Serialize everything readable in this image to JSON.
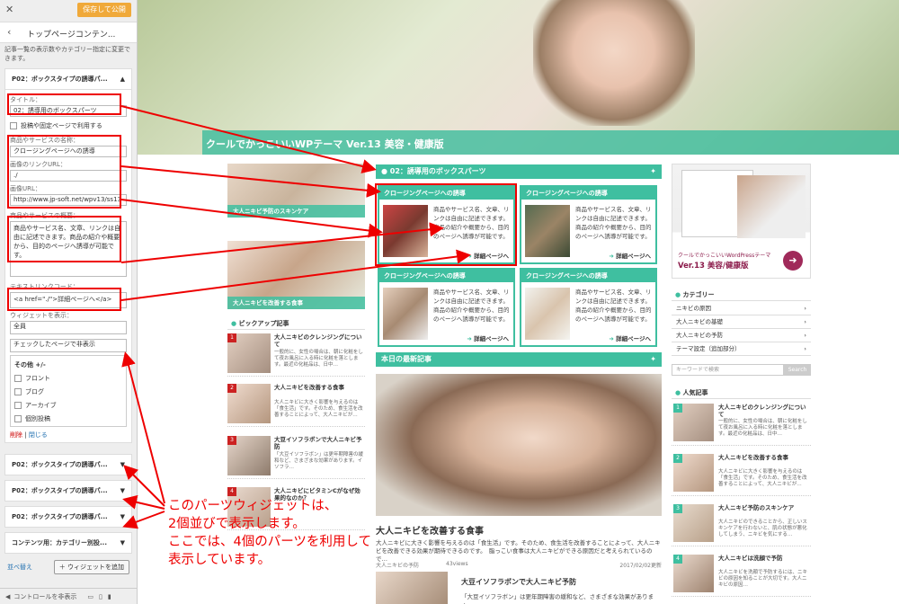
{
  "customizer": {
    "publish_label": "保存して公開",
    "section_title": "トップページコンテン...",
    "description": "記事一覧の表示数やカテゴリー指定に変更できます。",
    "widget_header": "P02：ボックスタイプの誘導パ...",
    "fields": {
      "title_label": "タイトル：",
      "title_value": "02：誘導用のボックスパーツ",
      "fixed_page_checkbox": "投稿や固定ページで利用する",
      "product_name_label": "商品やサービスの名称：",
      "product_name_value": "クロージングページへの誘導",
      "image_link_label": "画像のリンクURL：",
      "image_link_value": "./",
      "image_url_label": "画像URL：",
      "image_url_value": "http://www.jp-soft.net/wpv13/ss13",
      "summary_label": "商品やサービスの概要：",
      "summary_value": "商品やサービス名、文章、リンクは自由に記述できます。商品の紹介や概要から、目的のページへ誘導が可能です。",
      "text_link_label": "テキストリンクコード：",
      "text_link_value": "<a href=\"./\">詳細ページへ</a>",
      "widget_display_label": "ウィジェットを表示：",
      "widget_display_value": "全員",
      "hide_select_value": "チェックしたページで非表示",
      "list_header": "その他 +/-",
      "list_items": [
        "フロント",
        "ブログ",
        "アーカイブ",
        "個別投稿"
      ],
      "delete_label": "削除",
      "close_label": "閉じる"
    },
    "collapsed_widgets": [
      "P02：ボックスタイプの誘導パ...",
      "P02：ボックスタイプの誘導パ...",
      "P02：ボックスタイプの誘導パ...",
      "コンテンツ用：カテゴリー別投..."
    ],
    "reorder_label": "並べ替え",
    "add_widget_label": "＋ ウィジェットを追加",
    "hide_controls_label": "コントロールを非表示"
  },
  "site": {
    "hero_title": "クールでかっこいいWPテーマ Ver.13 美容・健康版",
    "box_section_title": "02：誘導用のボックスパーツ",
    "cards": [
      {
        "title": "クロージングページへの誘導",
        "text": "商品やサービス名、文章、リンクは自由に記述できます。商品の紹介や概要から、目的のページへ誘導が可能です。",
        "link": "詳細ページへ"
      },
      {
        "title": "クロージングページへの誘導",
        "text": "商品やサービス名、文章、リンクは自由に記述できます。商品の紹介や概要から、目的のページへ誘導が可能です。",
        "link": "詳細ページへ"
      },
      {
        "title": "クロージングページへの誘導",
        "text": "商品やサービス名、文章、リンクは自由に記述できます。商品の紹介や概要から、目的のページへ誘導が可能です。",
        "link": "詳細ページへ"
      },
      {
        "title": "クロージングページへの誘導",
        "text": "商品やサービス名、文章、リンクは自由に記述できます。商品の紹介や概要から、目的のページへ誘導が可能です。",
        "link": "詳細ページへ"
      }
    ],
    "side_banners": [
      "大人ニキビ予防のスキンケア",
      "大人ニキビを改善する食事"
    ],
    "pickup_title": "ピックアップ記事",
    "pickup_items": [
      {
        "num": "1",
        "title": "大人ニキビのクレンジングについて",
        "desc": "一般的に、女性の場合は、朝に化粧をして夜お風呂に入る時に化粧を落とします。最近の化粧品は、日中…"
      },
      {
        "num": "2",
        "title": "大人ニキビを改善する食事",
        "desc": "大人ニキビに大きく影響を与えるのは「食生活」です。そのため、食生活を改善することによって、大人ニキビが…"
      },
      {
        "num": "3",
        "title": "大豆イソフラボンで大人ニキビ予防",
        "desc": "「大豆イソフラボン」は更年期障害の緩和など、さまざまな効果があります。イソフラ…"
      },
      {
        "num": "4",
        "title": "大人ニキビにビタミンCがなぜ効果的なのか？",
        "desc": ""
      }
    ],
    "latest_title": "本日の最新記事",
    "article_title": "大人ニキビを改善する食事",
    "article_text": "大人ニキビに大きく影響を与えるのは「食生活」です。そのため、食生活を改善することによって、大人ニキビを改善できる効果が期待できるのです。　脂っこい食事は大人ニキビができる原因だと考えられているので…",
    "article_meta": [
      "大人ニキビの予防",
      "43views",
      "2017/02/02更新"
    ],
    "article2_title": "大豆イソフラボンで大人ニキビ予防",
    "article2_text": "「大豆イソフラボン」は更年期障害の緩和など、さまざまな効果があります。",
    "ad": {
      "line1": "クールでかっこいいWordPressテーマ",
      "line2": "Ver.13 美容/健康版"
    },
    "category_title": "カテゴリー",
    "categories": [
      "ニキビの原因",
      "大人ニキビの基礎",
      "大人ニキビの予防",
      "テーマ設定（追加部分）"
    ],
    "search_placeholder": "キーワードで検索",
    "search_button": "Search",
    "popular_title": "人気記事",
    "popular_items": [
      {
        "num": "1",
        "title": "大人ニキビのクレンジングについて",
        "desc": "一般的に、女性の場合は、朝に化粧をして夜お風呂に入る時に化粧を落とします。最近の化粧品は、日中…"
      },
      {
        "num": "2",
        "title": "大人ニキビを改善する食事",
        "desc": "大人ニキビに大きく影響を与えるのは「食生活」です。そのため、食生活を改善することによって、大人ニキビが…"
      },
      {
        "num": "3",
        "title": "大人ニキビ予防のスキンケア",
        "desc": "大人ニキビのできることから、正しいスキンケアを行わないと、肌の状態が悪化してしまう、ニキビを気にする…"
      },
      {
        "num": "4",
        "title": "大人ニキビは洗顔で予防",
        "desc": "大人ニキビを洗顔で予防するには、ニキビの原因を知ることが大切です。大人ニキビの原因…"
      }
    ]
  },
  "annotation": {
    "line1": "このパーツウィジェットは、",
    "line2": "2個並びで表示します。",
    "line3": "ここでは、4個のパーツを利用して",
    "line4": "表示しています。"
  }
}
